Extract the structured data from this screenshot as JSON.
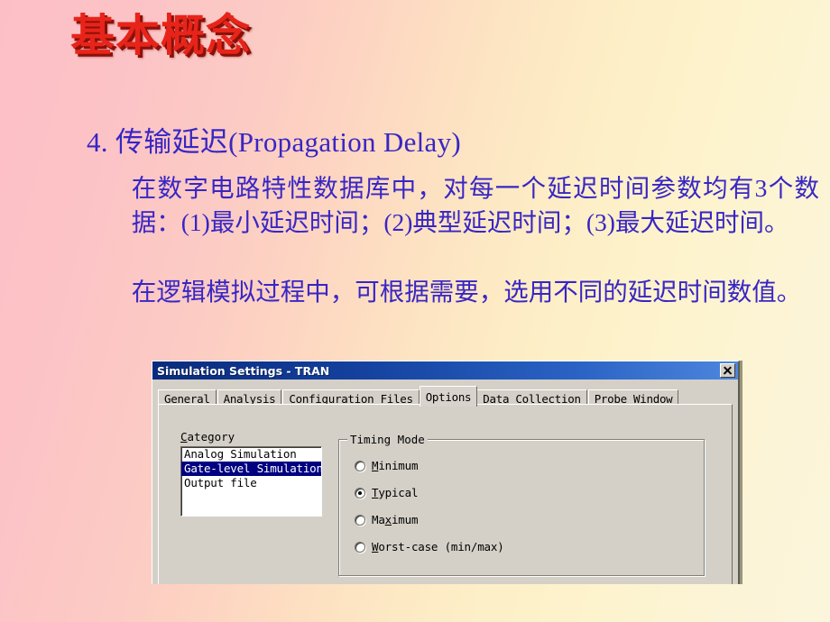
{
  "slide": {
    "title": "基本概念",
    "heading": "4. 传输延迟(Propagation Delay)",
    "paragraph_1": "在数字电路特性数据库中，对每一个延迟时间参数均有3个数据：(1)最小延迟时间；(2)典型延迟时间；(3)最大延迟时间。",
    "paragraph_2": "在逻辑模拟过程中，可根据需要，选用不同的延迟时间数值。",
    "title_color": "#e8241a",
    "text_color": "#3826c4",
    "background_from": "#fcbfc6",
    "background_to": "#fbf5dd"
  },
  "dialog": {
    "titlebar": {
      "title": "Simulation Settings - TRAN",
      "close_label": "×"
    },
    "tabs": [
      {
        "label": "General",
        "active": false
      },
      {
        "label": "Analysis",
        "active": false
      },
      {
        "label": "Configuration Files",
        "active": false
      },
      {
        "label": "Options",
        "active": true
      },
      {
        "label": "Data Collection",
        "active": false
      },
      {
        "label": "Probe Window",
        "active": false
      }
    ],
    "category": {
      "label": "Category",
      "label_mnemonic": "C",
      "label_rest": "ategory",
      "items": [
        {
          "label": "Analog Simulation",
          "selected": false
        },
        {
          "label": "Gate-level Simulation",
          "selected": true
        },
        {
          "label": "Output file",
          "selected": false
        }
      ]
    },
    "timing_mode": {
      "title": "Timing Mode",
      "options": [
        {
          "pre": "",
          "mnemonic": "M",
          "post": "inimum",
          "checked": false
        },
        {
          "pre": "",
          "mnemonic": "T",
          "post": "ypical",
          "checked": true
        },
        {
          "pre": "Ma",
          "mnemonic": "x",
          "post": "imum",
          "checked": false
        },
        {
          "pre": "",
          "mnemonic": "W",
          "post": "orst-case (min/max)",
          "checked": false
        }
      ]
    },
    "colors": {
      "face": "#d4d0c8",
      "titlebar_start": "#0a2a7c",
      "titlebar_end": "#4d86dd",
      "selection": "#000080"
    }
  }
}
